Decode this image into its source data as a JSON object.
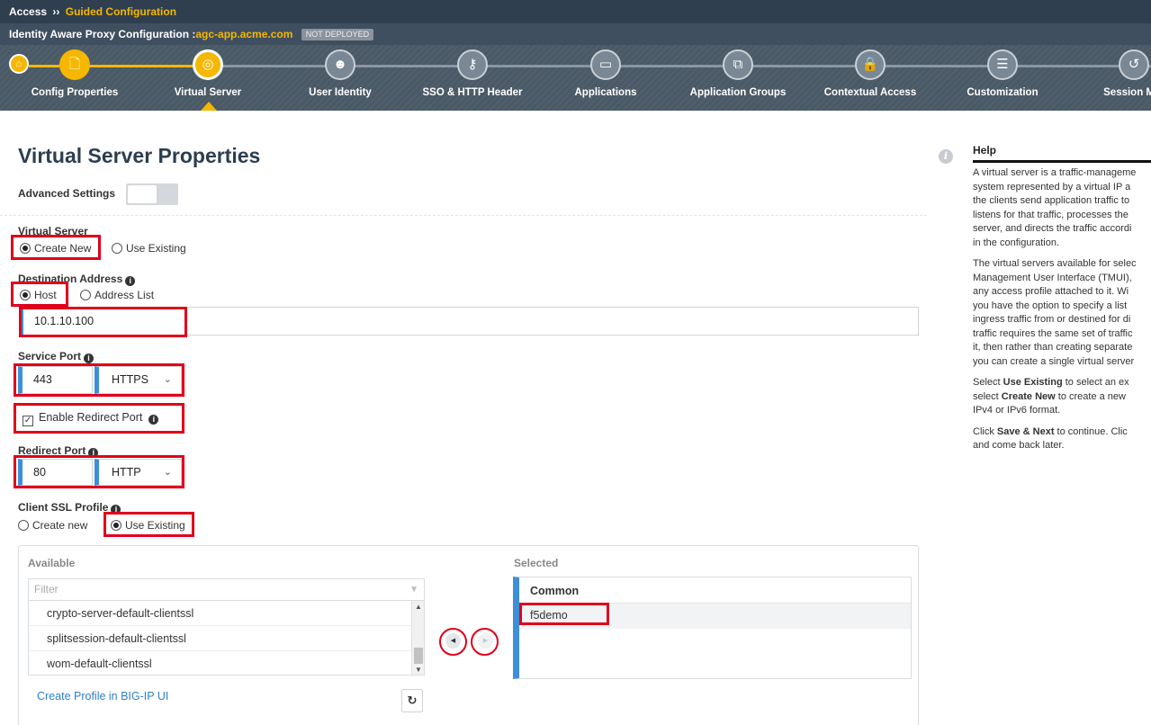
{
  "breadcrumb": {
    "root": "Access",
    "separator": "››",
    "current": "Guided Configuration"
  },
  "title_bar": {
    "prefix": "Identity Aware Proxy Configuration :",
    "host": "agc-app.acme.com",
    "badge": "NOT DEPLOYED"
  },
  "steps": [
    {
      "label": "Config Properties",
      "icon": "document-icon",
      "glyph": "🗋",
      "state": "done"
    },
    {
      "label": "Virtual Server",
      "icon": "globe-icon",
      "glyph": "◎",
      "state": "current"
    },
    {
      "label": "User Identity",
      "icon": "users-icon",
      "glyph": "☻",
      "state": "pending"
    },
    {
      "label": "SSO & HTTP Header",
      "icon": "key-icon",
      "glyph": "⚷",
      "state": "pending"
    },
    {
      "label": "Applications",
      "icon": "window-icon",
      "glyph": "▭",
      "state": "pending"
    },
    {
      "label": "Application Groups",
      "icon": "windows-icon",
      "glyph": "⧉",
      "state": "pending"
    },
    {
      "label": "Contextual Access",
      "icon": "lock-icon",
      "glyph": "🔒",
      "state": "pending"
    },
    {
      "label": "Customization",
      "icon": "sliders-icon",
      "glyph": "☰",
      "state": "pending"
    },
    {
      "label": "Session Mar",
      "icon": "history-icon",
      "glyph": "↺",
      "state": "pending"
    }
  ],
  "page": {
    "title": "Virtual Server Properties",
    "advanced_settings_label": "Advanced Settings"
  },
  "virtual_server": {
    "label": "Virtual Server",
    "options": [
      "Create New",
      "Use Existing"
    ],
    "selected": "Create New"
  },
  "destination": {
    "label": "Destination Address",
    "options": [
      "Host",
      "Address List"
    ],
    "selected": "Host",
    "value": "10.1.10.100"
  },
  "service_port": {
    "label": "Service Port",
    "port": "443",
    "protocol": "HTTPS"
  },
  "redirect": {
    "enable_label": "Enable Redirect Port",
    "enabled": true,
    "label": "Redirect Port",
    "port": "80",
    "protocol": "HTTP"
  },
  "client_ssl": {
    "label": "Client SSL Profile",
    "options": [
      "Create new",
      "Use Existing"
    ],
    "selected": "Use Existing",
    "available_header": "Available",
    "selected_header": "Selected",
    "filter_placeholder": "Filter",
    "available_items": [
      "crypto-server-default-clientssl",
      "splitsession-default-clientssl",
      "wom-default-clientssl"
    ],
    "selected_group": "Common",
    "selected_items": [
      "f5demo"
    ],
    "create_link": "Create Profile in BIG-IP UI"
  },
  "help": {
    "title": "Help",
    "p1": [
      "A virtual server is a traffic-manageme",
      "system represented by a virtual IP a",
      "the clients send application traffic to",
      "listens for that traffic, processes the",
      "server, and directs the traffic accordi",
      "in the configuration."
    ],
    "p2": [
      "The virtual servers available for selec",
      "Management User Interface (TMUI),",
      "any access profile attached to it. Wi",
      "you have the option to specify a list",
      "ingress traffic from or destined for di",
      "traffic requires the same set of traffic",
      "it, then rather than creating separate",
      "you can create a single virtual server"
    ],
    "p3": {
      "l1_pre": "Select ",
      "l1_bold": "Use Existing",
      "l1_post": " to select an ex",
      "l2_pre": "select ",
      "l2_bold": "Create New",
      "l2_post": " to create a new",
      "l3": "IPv4 or IPv6 format."
    },
    "p4": {
      "l1_pre": "Click ",
      "l1_bold": "Save & Next",
      "l1_post": " to continue. Clic",
      "l2": "and come back later."
    }
  },
  "colors": {
    "accent": "#f5b700",
    "input_accent": "#3d8fd9",
    "highlight": "#e0001b"
  }
}
